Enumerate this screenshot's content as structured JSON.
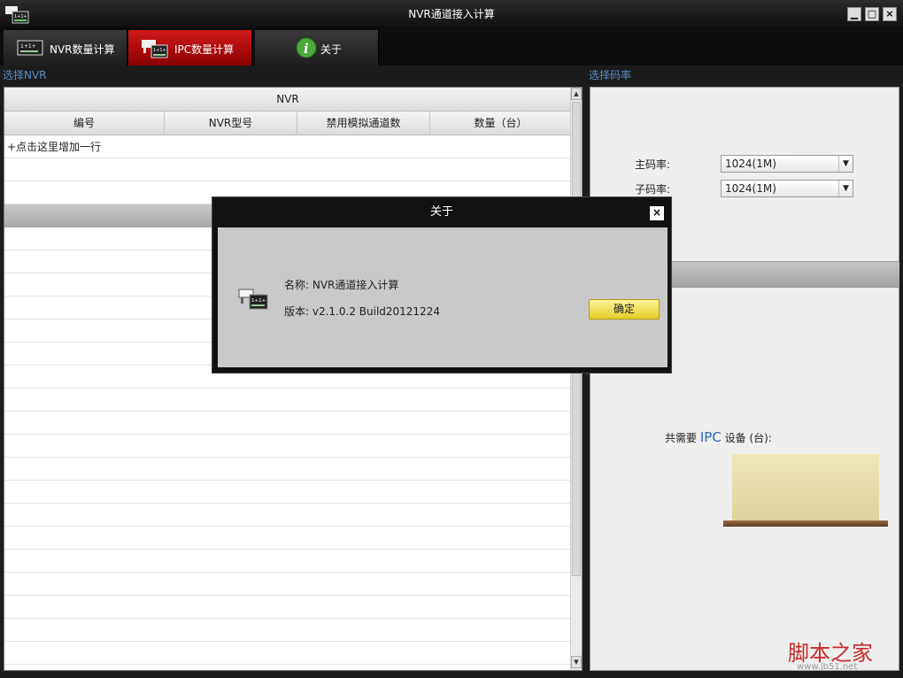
{
  "window": {
    "title": "NVR通道接入计算",
    "min_glyph": "▁",
    "max_glyph": "□",
    "close_glyph": "×"
  },
  "tabs": [
    {
      "label": "NVR数量计算",
      "icon": "nvr-device-icon"
    },
    {
      "label": "IPC数量计算",
      "icon": "ipc-camera-icon",
      "active": true
    },
    {
      "label": "关于",
      "icon": "info-icon"
    }
  ],
  "left": {
    "section_label": "选择NVR",
    "table_group_header": "NVR",
    "columns": [
      "编号",
      "NVR型号",
      "禁用模拟通道数",
      "数量（台）"
    ],
    "add_row_text": "+点击这里增加一行"
  },
  "right": {
    "section_label": "选择码率",
    "main_rate_label": "主码率:",
    "main_rate_value": "1024(1M)",
    "sub_rate_label": "子码率:",
    "sub_rate_value": "1024(1M)",
    "total_prefix": "共需要",
    "total_ipc": "IPC",
    "total_suffix": "设备 (台):"
  },
  "dialog": {
    "title": "关于",
    "name_label": "名称:",
    "name_value": "NVR通道接入计算",
    "version_label": "版本:",
    "version_value": "v2.1.0.2 Build20121224",
    "ok_label": "确定",
    "close_glyph": "×"
  },
  "watermark": {
    "text": "脚本之家",
    "sub": "www.jb51.net"
  },
  "colors": {
    "active_tab": "#c30d0d",
    "accent_blue": "#5a8cc7",
    "ok_button": "#f0dc4a"
  }
}
